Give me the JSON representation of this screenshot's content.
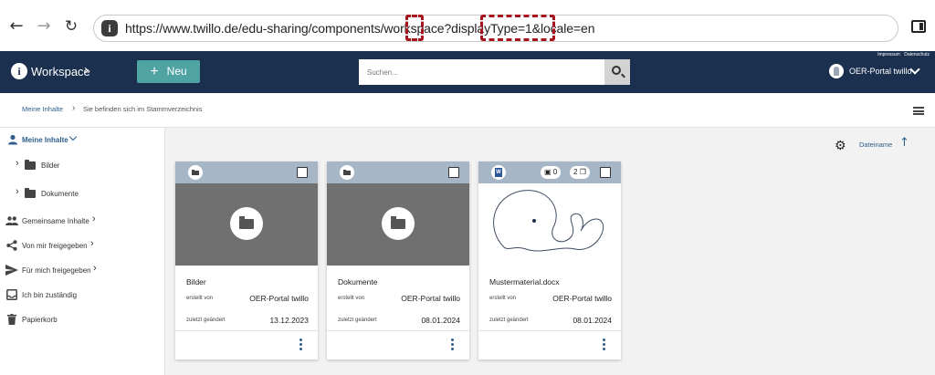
{
  "browser": {
    "back_icon": "arrow-left-icon",
    "forward_icon": "arrow-right-icon",
    "reload_icon": "reload-icon",
    "url": "https://www.twillo.de/edu-sharing/components/workspace?displayType=1&locale=en",
    "highlight_color": "#a8141e"
  },
  "header": {
    "title": "Workspace",
    "new_label": "Neu",
    "search_placeholder": "Suchen...",
    "impressum": "Impressum",
    "datenschutz": "Datenschutz",
    "user_name": "OER-Portal twillo",
    "background_color": "#1b2f4e",
    "accent_color": "#4fa3a3"
  },
  "breadcrumb": {
    "home": "Meine Inhalte",
    "current": "Sie befinden sich im Stammverzeichnis"
  },
  "sidebar": {
    "items": [
      {
        "label": "Meine Inhalte",
        "icon": "person-icon"
      },
      {
        "label": "Bilder",
        "icon": "folder-icon"
      },
      {
        "label": "Dokumente",
        "icon": "folder-icon"
      },
      {
        "label": "Gemeinsame Inhalte",
        "icon": "group-icon"
      },
      {
        "label": "Von mir freigegeben",
        "icon": "share-icon"
      },
      {
        "label": "Für mich freigegeben",
        "icon": "send-icon"
      },
      {
        "label": "Ich bin zuständig",
        "icon": "inbox-icon"
      },
      {
        "label": "Papierkorb",
        "icon": "trash-icon"
      }
    ]
  },
  "sort": {
    "label": "Dateiname",
    "direction": "ascending"
  },
  "cards": [
    {
      "title": "Bilder",
      "type": "folder",
      "created_by_label": "erstellt von",
      "created_by": "OER-Portal twillo",
      "modified_label": "zuletzt geändert",
      "modified": "13.12.2023"
    },
    {
      "title": "Dokumente",
      "type": "folder",
      "created_by_label": "erstellt von",
      "created_by": "OER-Portal twillo",
      "modified_label": "zuletzt geändert",
      "modified": "08.01.2024"
    },
    {
      "title": "Mustermaterial.docx",
      "type": "word-document",
      "badge": "W",
      "comments_count": "0",
      "collections_count": "2",
      "created_by_label": "erstellt von",
      "created_by": "OER-Portal twillo",
      "modified_label": "zuletzt geändert",
      "modified": "08.01.2024"
    }
  ]
}
